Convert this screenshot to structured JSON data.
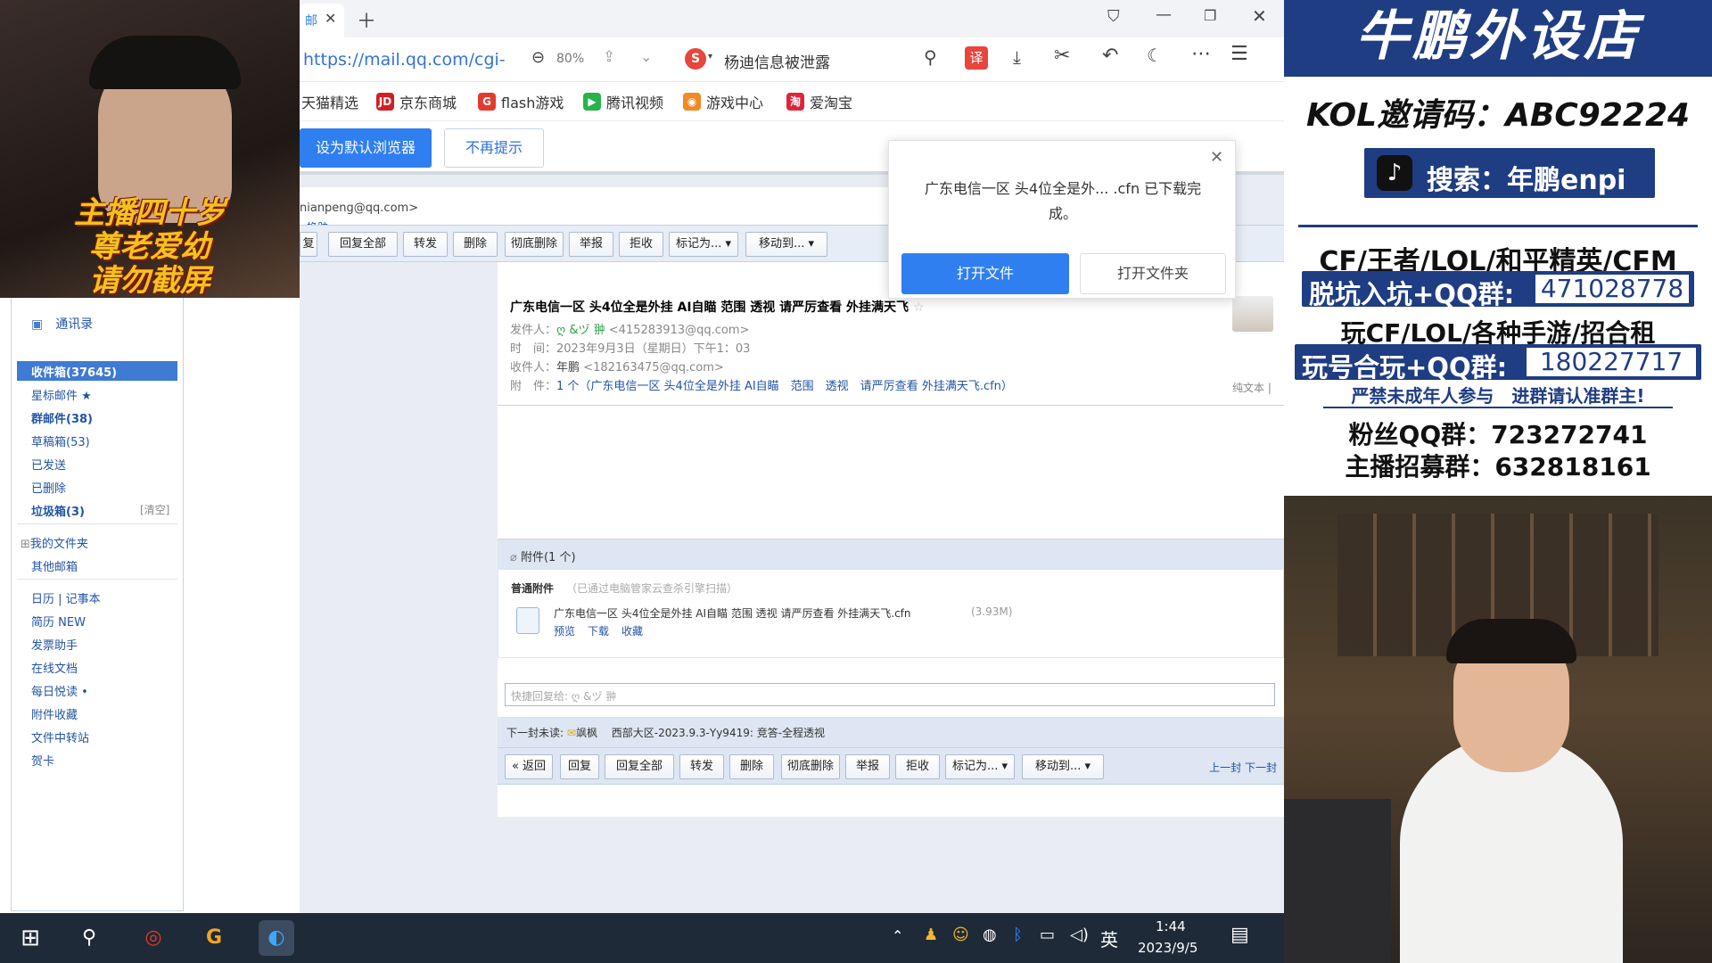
{
  "browser": {
    "tab_title": "邮",
    "zoom": "80%",
    "url": "https://mail.qq.com/cgi-",
    "search_hint": "杨迪信息被泄露",
    "bookmarks": [
      "天猫精选",
      "京东商城",
      "flash游戏",
      "腾讯视频",
      "游戏中心",
      "爱淘宝"
    ],
    "default_browser_btn": "设为默认浏览器",
    "no_remind_btn": "不再提示",
    "translate_label": "译"
  },
  "download_popup": {
    "message": "广东电信一区 头4位全是外... .cfn 已下载完成。",
    "open_file": "打开文件",
    "open_folder": "打开文件夹"
  },
  "mail_account": {
    "email": "nianpeng@qq.com>",
    "switch": "- 换肤"
  },
  "sidebar": {
    "contacts": "通讯录",
    "items": [
      {
        "label": "收件箱(37645)"
      },
      {
        "label": "星标邮件 ★"
      },
      {
        "label": "群邮件(38)"
      },
      {
        "label": "草稿箱(53)"
      },
      {
        "label": "已发送"
      },
      {
        "label": "已删除"
      },
      {
        "label": "垃圾箱(3)",
        "extra": "[清空]"
      }
    ],
    "folders": [
      "我的文件夹",
      "其他邮箱"
    ],
    "tools": [
      "日历 | 记事本",
      "简历 NEW",
      "发票助手",
      "在线文档",
      "每日悦读 •",
      "附件收藏",
      "文件中转站",
      "贺卡"
    ]
  },
  "toolbar": {
    "buttons": [
      "复",
      "回复全部",
      "转发",
      "删除",
      "彻底删除",
      "举报",
      "拒收",
      "标记为... ▾",
      "移动到... ▾"
    ],
    "bottom_buttons": [
      "« 返回",
      "回复",
      "回复全部",
      "转发",
      "删除",
      "彻底删除",
      "举报",
      "拒收",
      "标记为... ▾",
      "移动到... ▾"
    ],
    "prev_next": "上一封 下一封"
  },
  "email": {
    "subject": "广东电信一区 头4位全是外挂 AI自瞄 范围 透视 请严厉查看 外挂满天飞",
    "from_label": "发件人：",
    "from_name": "ღ &ヅ 翀",
    "from_addr": "<415283913@qq.com>",
    "time_label": "时　间：",
    "time": "2023年9月3日（星期日）下午1：03",
    "to_label": "收件人：",
    "to_name": "年鹏",
    "to_addr": "<182163475@qq.com>",
    "attach_label": "附　件：",
    "attach_summary": "1 个（广东电信一区 头4位全是外挂 AI自瞄　范围　透视　请严厉查看 外挂满天飞.cfn）",
    "plaintext": "纯文本 |",
    "attachments_header": "附件(1 个)",
    "normal_attach": "普通附件",
    "scan_note": "（已通过电脑管家云查杀引擎扫描）",
    "file_name": "广东电信一区 头4位全是外挂 AI自瞄 范围 透视 请严厉查看 外挂满天飞.cfn",
    "file_size": "(3.93M)",
    "file_actions": [
      "预览",
      "下载",
      "收藏"
    ],
    "quick_reply": "快捷回复给: ღ &ヅ 翀",
    "next_mail_label": "下一封未读:",
    "next_mail_from": "飒枫",
    "next_mail_subject": "西部大区-2023.9.3-Yy9419: 竞答-全程透视"
  },
  "left_cam": {
    "caption_lines": [
      "主播四十岁",
      "尊老爱幼",
      "请勿截屏"
    ]
  },
  "right_panel": {
    "title": "牛鹏外设店",
    "kol": "KOL邀请码：ABC92224",
    "douyin": "搜索：年鹏enpi",
    "games": "CF/王者/LOL/和平精英/CFM",
    "group1_label": "脱坑入坑+QQ群:",
    "group1_num": "471028778",
    "rent": "玩CF/LOL/各种手游/招合租",
    "group2_label": "玩号合玩+QQ群:",
    "group2_num": "180227717",
    "warning": "严禁未成年人参与　进群请认准群主!",
    "fans": "粉丝QQ群：723272741",
    "recruit": "主播招募群：632818161"
  },
  "taskbar": {
    "lang": "英",
    "time": "1:44",
    "date": "2023/9/5"
  },
  "colors": {
    "accent": "#2f7ff0",
    "navy": "#1f3d82",
    "mail_blue": "#2254a4"
  }
}
